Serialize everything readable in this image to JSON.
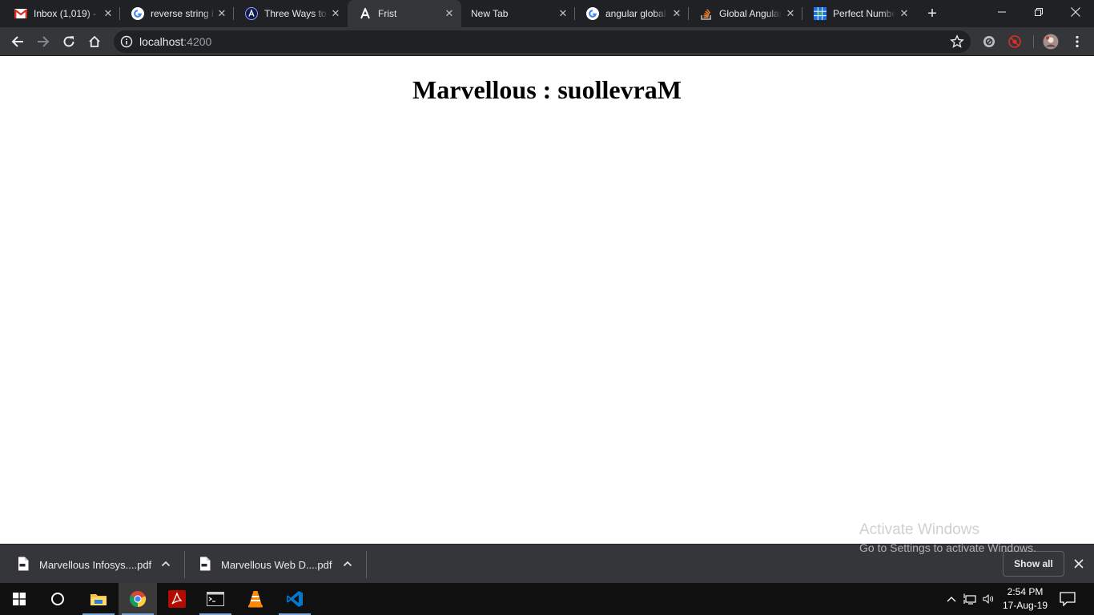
{
  "browser": {
    "tabs": [
      {
        "title": "Inbox (1,019) - ",
        "icon": "gmail-icon"
      },
      {
        "title": "reverse string i",
        "icon": "google-icon"
      },
      {
        "title": "Three Ways to",
        "icon": "angular-logo-icon"
      },
      {
        "title": "Frist",
        "icon": "angular-icon",
        "active": true
      },
      {
        "title": "New Tab",
        "icon": ""
      },
      {
        "title": "angular global",
        "icon": "google-icon"
      },
      {
        "title": "Global Angular",
        "icon": "stackoverflow-icon"
      },
      {
        "title": "Perfect Numbe",
        "icon": "grid-icon"
      }
    ],
    "url_host": "localhost",
    "url_port": ":4200"
  },
  "page": {
    "heading": "Marvellous : suollevraM"
  },
  "downloads": {
    "items": [
      {
        "name": "Marvellous Infosys....pdf"
      },
      {
        "name": "Marvellous Web D....pdf"
      }
    ],
    "show_all_label": "Show all"
  },
  "watermark": {
    "line1": "Activate Windows",
    "line2": "Go to Settings to activate Windows."
  },
  "taskbar": {
    "time": "2:54 PM",
    "date": "17-Aug-19",
    "apps": [
      "windows-start-icon",
      "cortana-icon",
      "file-explorer-icon",
      "chrome-icon",
      "acrobat-icon",
      "terminal-icon",
      "vlc-icon",
      "vscode-icon"
    ]
  },
  "colors": {
    "chrome_dark": "#202124",
    "toolbar": "#35363a",
    "taskbar": "#101010",
    "text_light": "#e8eaed"
  }
}
